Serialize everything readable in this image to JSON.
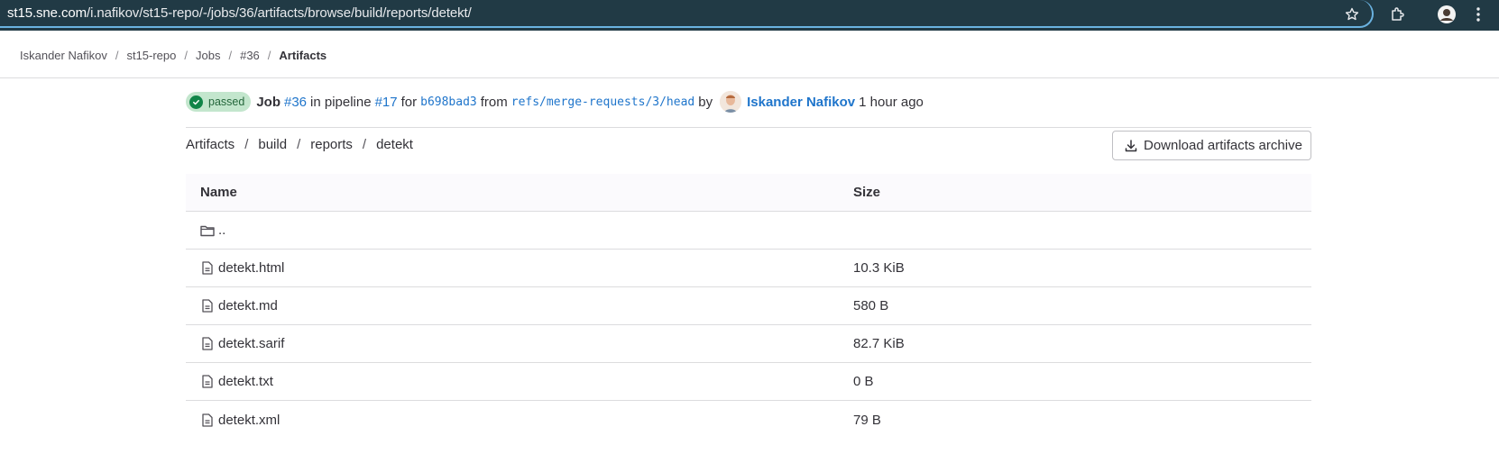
{
  "browser": {
    "url_domain": "st15.sne.com",
    "url_path": "/i.nafikov/st15-repo/-/jobs/36/artifacts/browse/build/reports/detekt/"
  },
  "breadcrumbs": [
    {
      "label": "Iskander Nafikov"
    },
    {
      "label": "st15-repo"
    },
    {
      "label": "Jobs"
    },
    {
      "label": "#36"
    },
    {
      "label": "Artifacts"
    }
  ],
  "job": {
    "status": "passed",
    "job_word": "Job",
    "job_id": "#36",
    "in_pipeline": "in pipeline",
    "pipeline_id": "#17",
    "for_word": "for",
    "commit": "b698bad3",
    "from_word": "from",
    "ref": "refs/merge-requests/3/head",
    "by_word": "by",
    "author": "Iskander Nafikov",
    "time": "1 hour ago"
  },
  "path": [
    "Artifacts",
    "build",
    "reports",
    "detekt"
  ],
  "download_button": "Download artifacts archive",
  "table": {
    "headers": {
      "name": "Name",
      "size": "Size"
    },
    "parent": "..",
    "files": [
      {
        "name": "detekt.html",
        "size": "10.3 KiB"
      },
      {
        "name": "detekt.md",
        "size": "580 B"
      },
      {
        "name": "detekt.sarif",
        "size": "82.7 KiB"
      },
      {
        "name": "detekt.txt",
        "size": "0 B"
      },
      {
        "name": "detekt.xml",
        "size": "79 B"
      }
    ]
  },
  "colors": {
    "chrome": "#213a45",
    "link": "#1f75cb",
    "success": "#108548"
  }
}
